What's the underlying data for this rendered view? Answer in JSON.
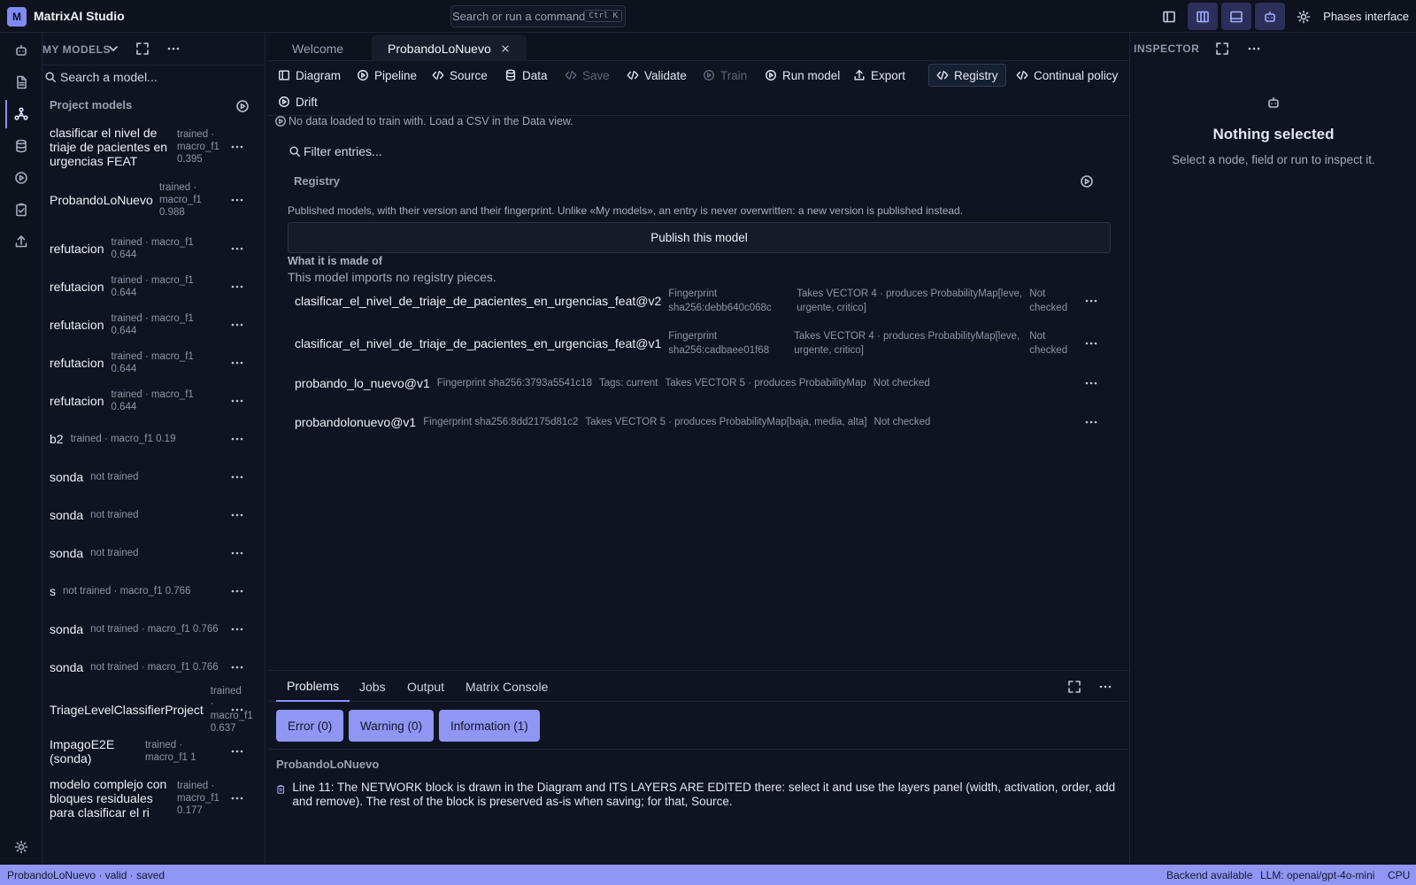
{
  "app": {
    "logo": "M",
    "title": "MatrixAI Studio"
  },
  "command": {
    "placeholder": "Search or run a command",
    "shortcut": "Ctrl K"
  },
  "topbar": {
    "phases_label": "Phases interface"
  },
  "sidebar": {
    "header": "MY MODELS",
    "search_placeholder": "Search a model...",
    "section": "Project models",
    "models": [
      {
        "name": "clasificar el nivel de triaje de pacientes en urgencias FEAT",
        "status": "trained · macro_f1 0.395"
      },
      {
        "name": "ProbandoLoNuevo",
        "status": "trained · macro_f1 0.988"
      },
      {
        "name": "refutacion",
        "status": "trained · macro_f1 0.644"
      },
      {
        "name": "refutacion",
        "status": "trained · macro_f1 0.644"
      },
      {
        "name": "refutacion",
        "status": "trained · macro_f1 0.644"
      },
      {
        "name": "refutacion",
        "status": "trained · macro_f1 0.644"
      },
      {
        "name": "refutacion",
        "status": "trained · macro_f1 0.644"
      },
      {
        "name": "b2",
        "status": "trained · macro_f1 0.19"
      },
      {
        "name": "sonda",
        "status": "not trained"
      },
      {
        "name": "sonda",
        "status": "not trained"
      },
      {
        "name": "sonda",
        "status": "not trained"
      },
      {
        "name": "s",
        "status": "not trained · macro_f1 0.766"
      },
      {
        "name": "sonda",
        "status": "not trained · macro_f1 0.766"
      },
      {
        "name": "sonda",
        "status": "not trained · macro_f1 0.766"
      },
      {
        "name": "TriageLevelClassifierProject",
        "status": "trained · macro_f1 0.637"
      },
      {
        "name": "ImpagoE2E (sonda)",
        "status": "trained · macro_f1 1"
      },
      {
        "name": "modelo complejo con bloques residuales para clasificar el ri",
        "status": "trained · macro_f1 0.177"
      }
    ]
  },
  "tabs": [
    {
      "label": "Welcome"
    },
    {
      "label": "ProbandoLoNuevo"
    }
  ],
  "toolbar": {
    "items": [
      {
        "label": "Diagram",
        "icon": "columns-icon"
      },
      {
        "label": "Pipeline",
        "icon": "play-icon"
      },
      {
        "label": "Source",
        "icon": "code-icon"
      },
      {
        "label": "Data",
        "icon": "database-icon"
      },
      {
        "label": "Save",
        "icon": "code-icon"
      },
      {
        "label": "Validate",
        "icon": "code-icon"
      },
      {
        "label": "Train",
        "icon": "play-icon"
      },
      {
        "label": "Run model",
        "icon": "play-icon"
      },
      {
        "label": "Export",
        "icon": "upload-icon"
      },
      {
        "label": "Registry",
        "icon": "code-icon"
      },
      {
        "label": "Continual policy",
        "icon": "code-icon"
      },
      {
        "label": "Drift",
        "icon": "play-icon"
      }
    ]
  },
  "editor": {
    "no_data": "No data loaded to train with. Load a CSV in the Data view.",
    "filter_placeholder": "Filter entries...",
    "registry_title": "Registry",
    "registry_desc": "Published models, with their version and their fingerprint. Unlike «My models», an entry is never overwritten: a new version is published instead.",
    "publish_label": "Publish this model",
    "made_title": "What it is made of",
    "made_desc": "This model imports no registry pieces.",
    "entries": [
      {
        "name": "clasificar_el_nivel_de_triaje_de_pacientes_en_urgencias_feat@v2",
        "fingerprint": "Fingerprint sha256:debb640c068c",
        "io": "Takes VECTOR 4 · produces ProbabilityMap[leve, urgente, critico]",
        "check": "Not checked"
      },
      {
        "name": "clasificar_el_nivel_de_triaje_de_pacientes_en_urgencias_feat@v1",
        "fingerprint": "Fingerprint sha256:cadbaee01f68",
        "io": "Takes VECTOR 4 · produces ProbabilityMap[leve, urgente, critico]",
        "check": "Not checked"
      },
      {
        "name": "probando_lo_nuevo@v1",
        "fingerprint": "Fingerprint sha256:3793a5541c18",
        "tags": "Tags: current",
        "io": "Takes VECTOR 5 · produces ProbabilityMap",
        "check": "Not checked"
      },
      {
        "name": "probandolonuevo@v1",
        "fingerprint": "Fingerprint sha256:8dd2175d81c2",
        "io": "Takes VECTOR 5 · produces ProbabilityMap[baja, media, alta]",
        "check": "Not checked"
      }
    ]
  },
  "panel": {
    "tabs": [
      "Problems",
      "Jobs",
      "Output",
      "Matrix Console"
    ],
    "filters": [
      "Error (0)",
      "Warning (0)",
      "Information (1)"
    ],
    "group": "ProbandoLoNuevo",
    "message": "Line 11: The NETWORK block is drawn in the Diagram and ITS LAYERS ARE EDITED there: select it and use the layers panel (width, activation, order, add and remove). The rest of the block is preserved as-is when saving; for that, Source."
  },
  "inspector": {
    "header": "INSPECTOR",
    "title": "Nothing selected",
    "subtitle": "Select a node, field or run to inspect it."
  },
  "statusbar": {
    "left": "ProbandoLoNuevo · valid · saved",
    "backend": "Backend available",
    "llm": "LLM: openai/gpt-4o-mini",
    "device": "CPU"
  },
  "colors": {
    "accent": "#8f96f4",
    "background": "#0f1420",
    "panel": "#0d121c"
  }
}
